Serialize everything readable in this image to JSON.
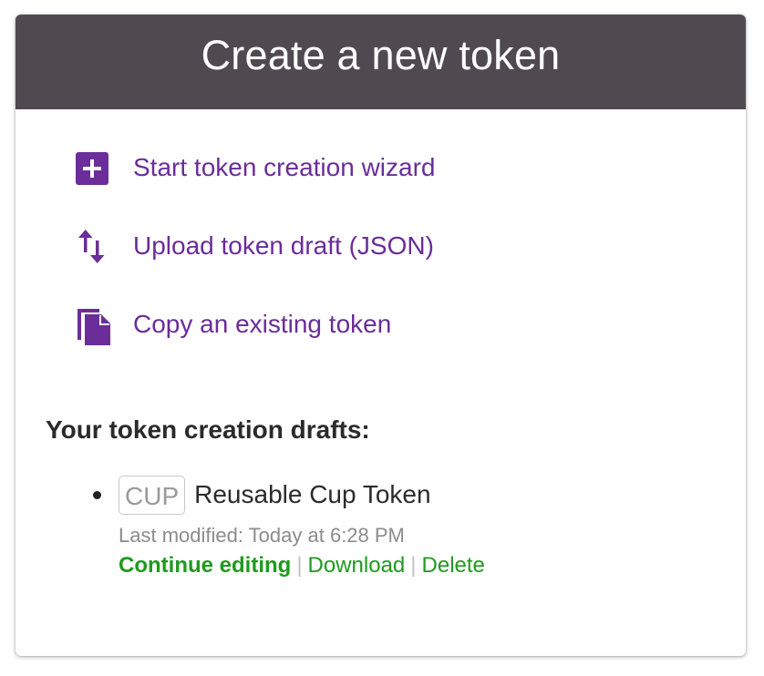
{
  "header": {
    "title": "Create a new token"
  },
  "actions": [
    {
      "label": "Start token creation wizard",
      "icon": "add-box-icon"
    },
    {
      "label": "Upload token draft (JSON)",
      "icon": "import-export-icon"
    },
    {
      "label": "Copy an existing token",
      "icon": "copy-document-icon"
    }
  ],
  "drafts": {
    "heading": "Your token creation drafts:",
    "items": [
      {
        "code": "CUP",
        "name": "Reusable Cup Token",
        "last_modified": "Last modified: Today at 6:28 PM",
        "continue_label": "Continue editing",
        "download_label": "Download",
        "delete_label": "Delete",
        "separator": "|"
      }
    ]
  },
  "colors": {
    "header_bg": "#504a50",
    "accent_purple": "#6a2d99",
    "link_green": "#1f9a1f"
  }
}
